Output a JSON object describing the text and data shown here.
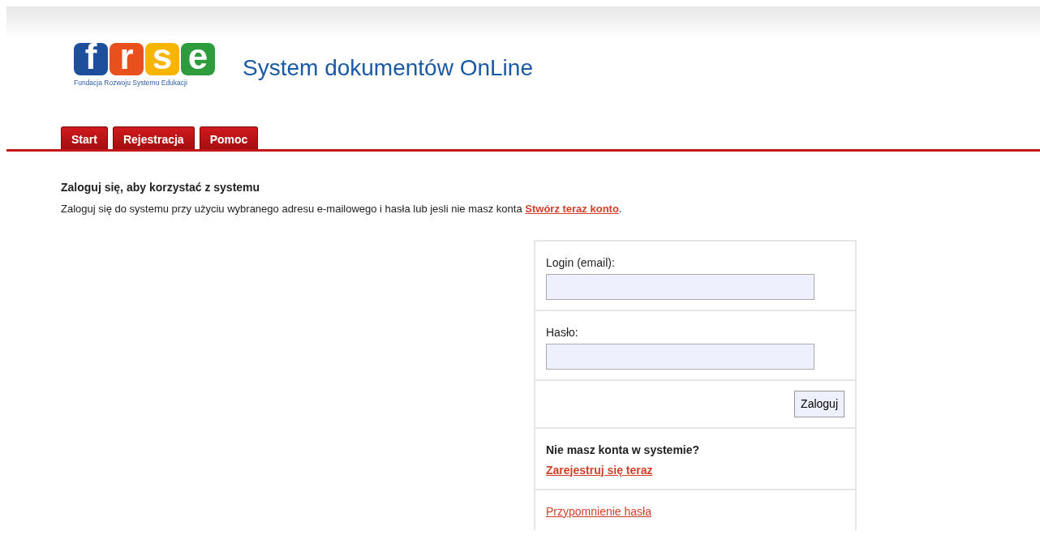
{
  "logo": {
    "letters": [
      {
        "text": "f",
        "color": "#1d4f9c"
      },
      {
        "text": "r",
        "color": "#e8501e"
      },
      {
        "text": "s",
        "color": "#f7b500"
      },
      {
        "text": "e",
        "color": "#2e9b3c"
      }
    ],
    "tagline": "Fundacja Rozwoju Systemu Edukacji"
  },
  "title": "System dokumentów OnLine",
  "tabs": [
    {
      "label": "Start",
      "selected": false
    },
    {
      "label": "Rejestracja",
      "selected": false
    },
    {
      "label": "Pomoc",
      "selected": false
    }
  ],
  "intro": {
    "heading": "Zaloguj się, aby korzystać z systemu",
    "text_before": "Zaloguj się do systemu przy użyciu wybranego adresu e-mailowego i hasła lub jesli nie masz konta ",
    "link": "Stwórz teraz konto",
    "text_after": "."
  },
  "login": {
    "fields": [
      {
        "label": "Login (email):"
      },
      {
        "label": "Hasło:"
      }
    ],
    "button": "Zaloguj",
    "no_account": "Nie masz konta w systemie?",
    "register_link": "Zarejestruj się teraz",
    "reminder_link": "Przypomnienie hasła"
  }
}
